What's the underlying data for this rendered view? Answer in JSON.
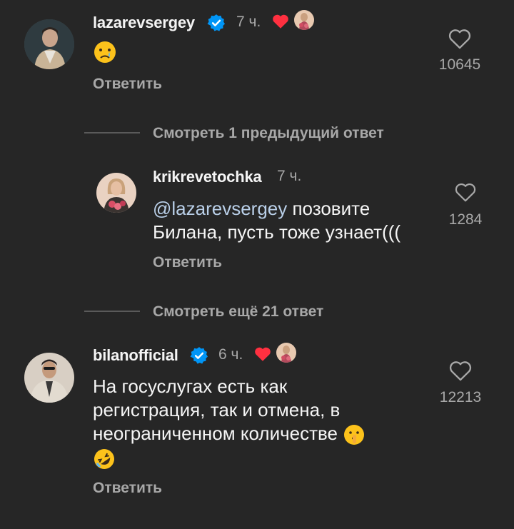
{
  "comments": [
    {
      "username": "lazarevsergey",
      "time": "7 ч.",
      "text": "",
      "reply_label": "Ответить",
      "likes": "10645"
    },
    {
      "username": "krikrevetochka",
      "time": "7 ч.",
      "mention": "@lazarevsergey",
      "text_line1": " позовите",
      "text_line2": "Билана, пусть тоже узнает(((",
      "reply_label": "Ответить",
      "likes": "1284"
    },
    {
      "username": "bilanofficial",
      "time": "6 ч.",
      "text_line1": "На госуслугах есть как",
      "text_line2": "регистрация, так и отмена, в",
      "text_line3": "неограниченном количестве",
      "reply_label": "Ответить",
      "likes": "12213"
    }
  ],
  "view_previous": "Смотреть 1 предыдущий ответ",
  "view_more": "Смотреть ещё 21 ответ",
  "icons": {
    "verified": "verified-badge-icon",
    "author_like": "heart-icon",
    "like": "heart-outline-icon"
  },
  "colors": {
    "background": "#262626",
    "heart_red": "#ff3040",
    "verified_blue": "#0095f6",
    "secondary_text": "#a8a8a8",
    "mention": "#b9cfe8"
  }
}
